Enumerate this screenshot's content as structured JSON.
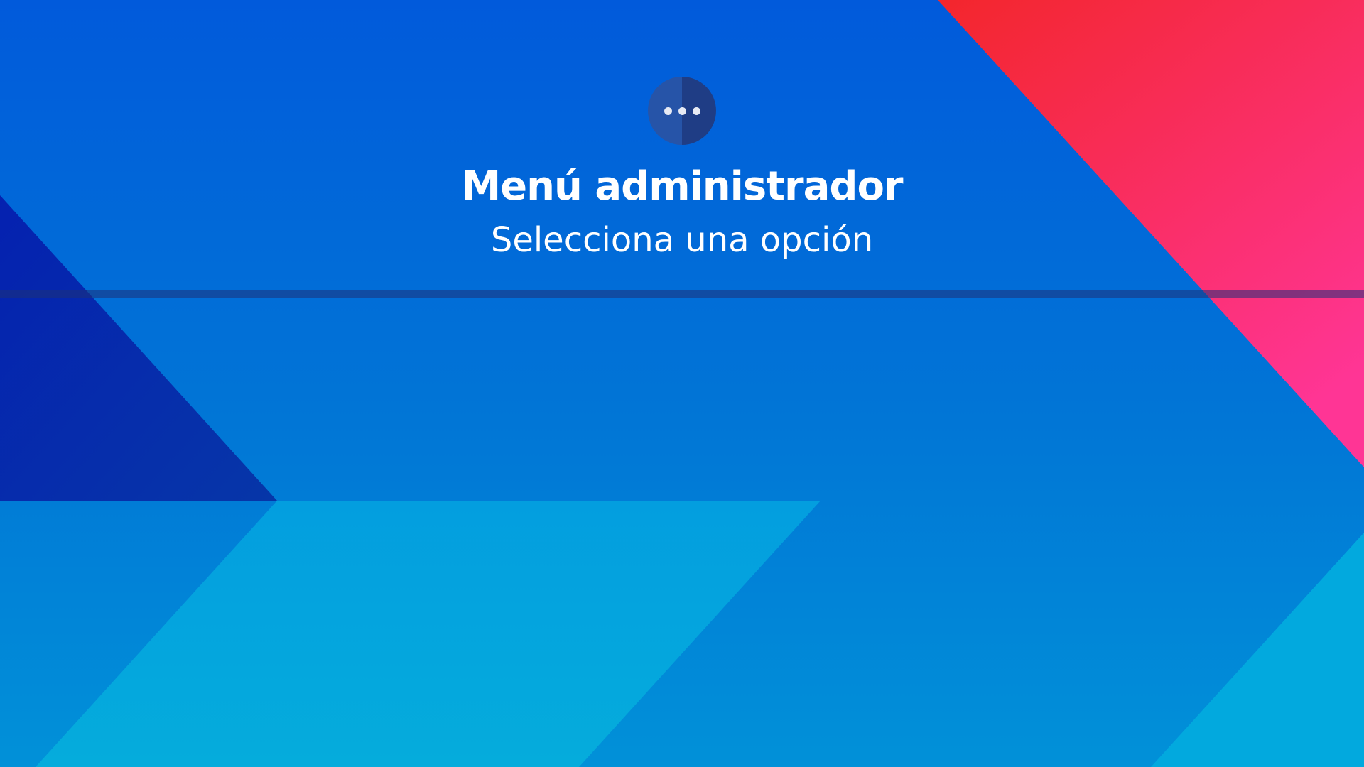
{
  "header": {
    "menu_icon": "more-horizontal-icon",
    "title": "Menú administrador",
    "subtitle": "Selecciona una opción"
  },
  "colors": {
    "background_blue": "#0a6ad8",
    "deep_blue": "#0a30b0",
    "light_cyan": "#04a9dd",
    "red_top": "#f22a30",
    "pink_bottom": "#ff3592",
    "icon_left": "#2654a8",
    "icon_right": "#1f3d85",
    "text": "#ffffff"
  }
}
